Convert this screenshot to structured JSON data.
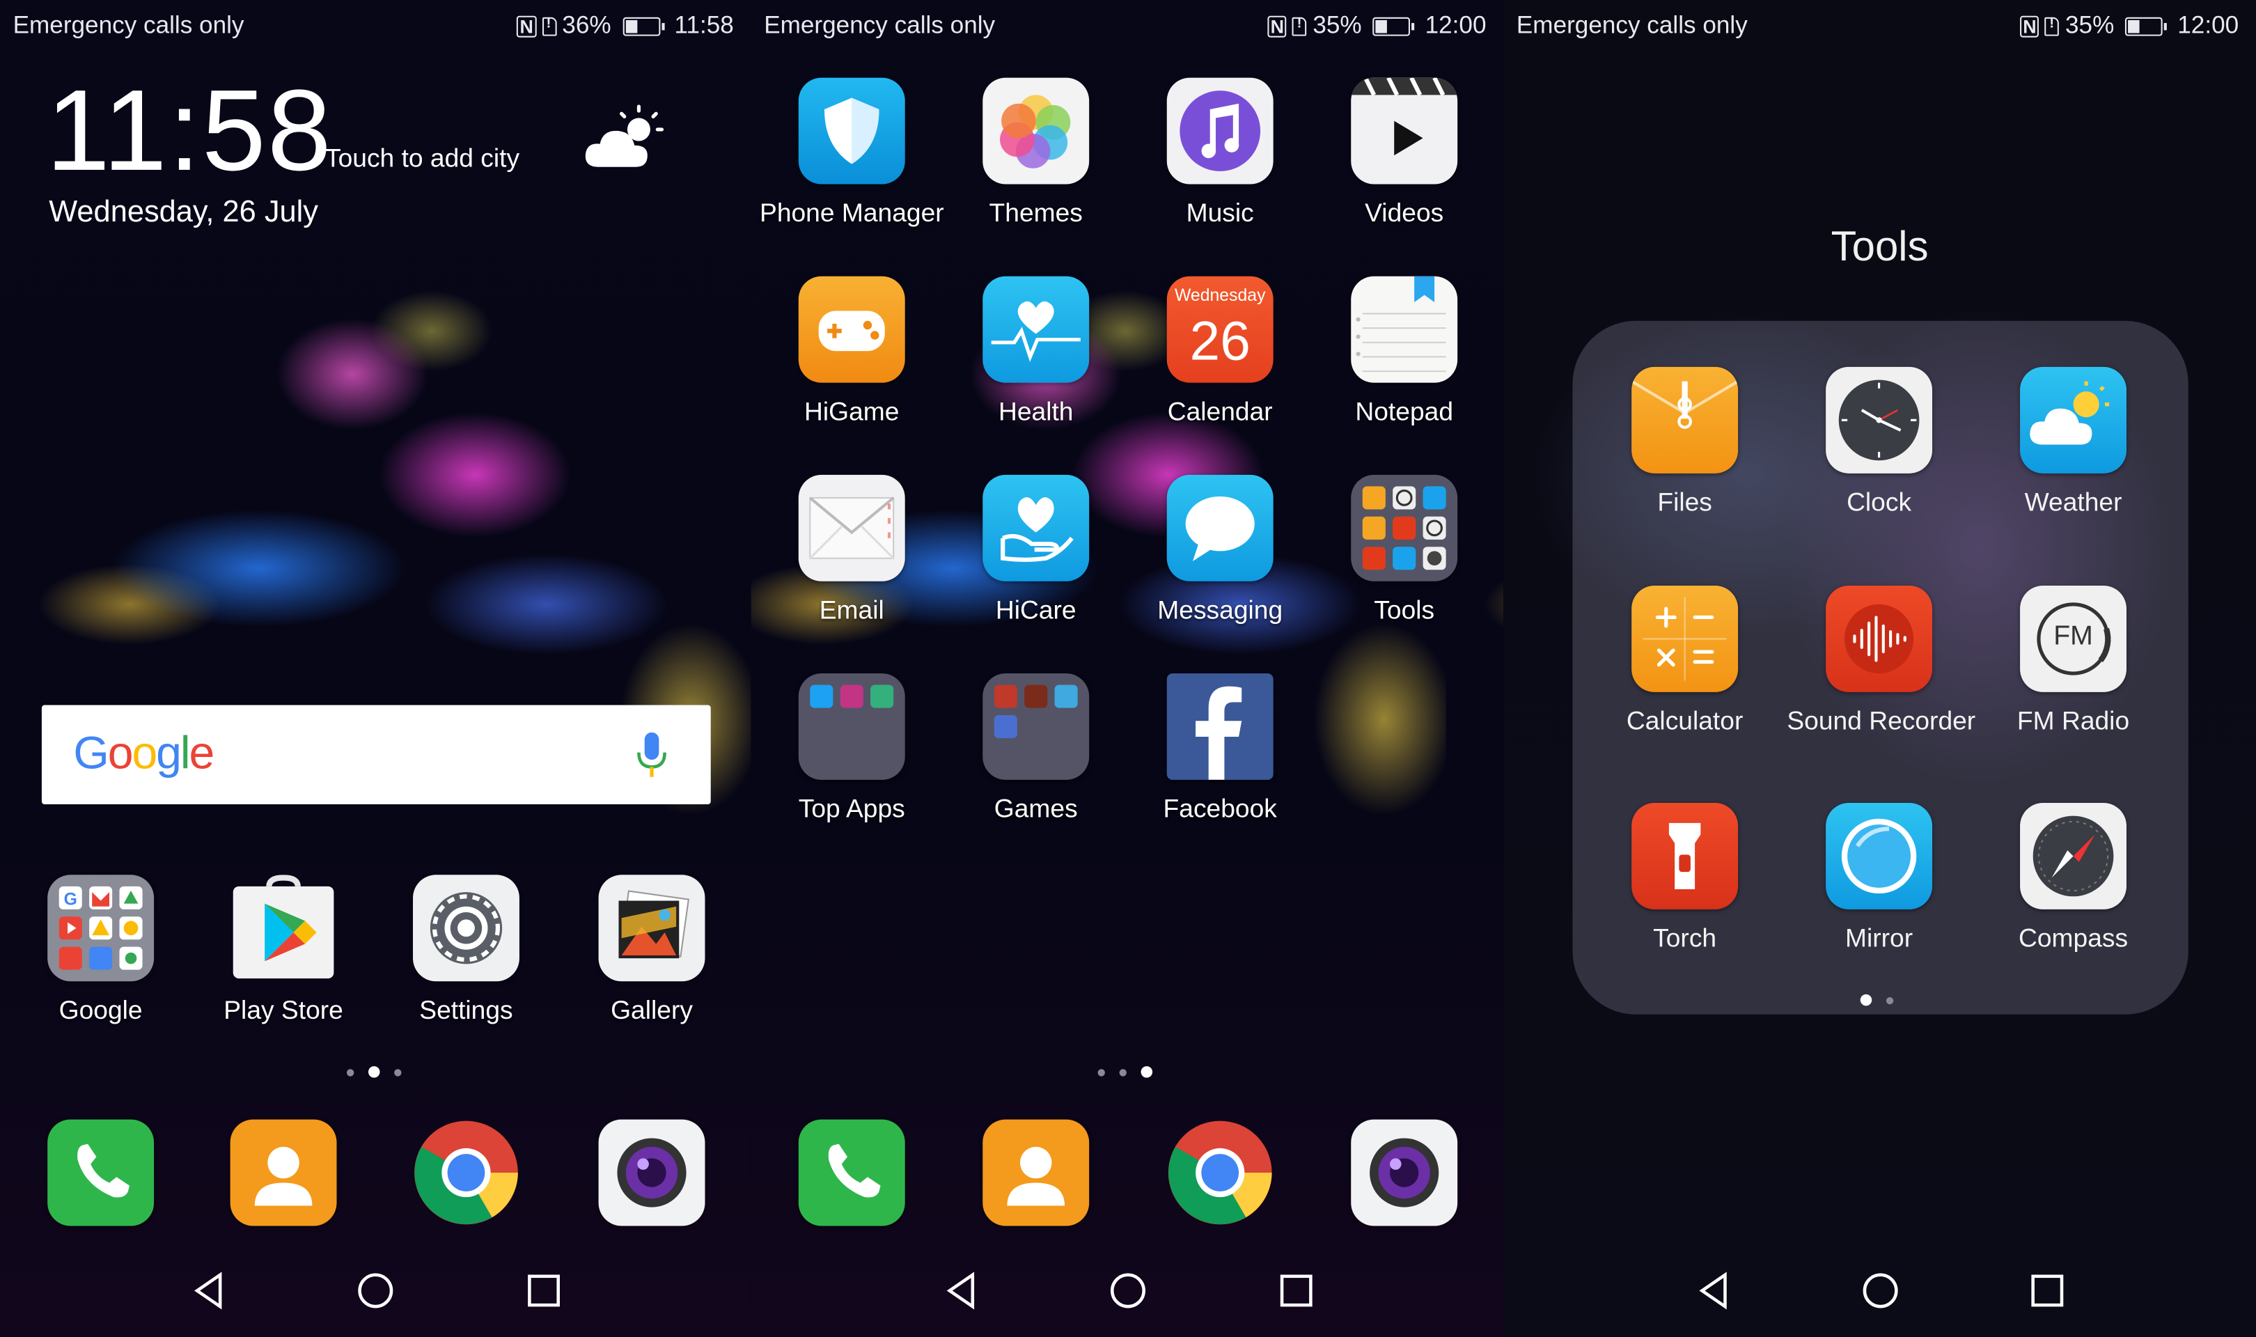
{
  "status_bars": [
    {
      "carrier": "Emergency calls only",
      "battery": "36%",
      "battery_level": 0.36,
      "time": "11:58",
      "nfc": "N"
    },
    {
      "carrier": "Emergency calls only",
      "battery": "35%",
      "battery_level": 0.35,
      "time": "12:00",
      "nfc": "N"
    },
    {
      "carrier": "Emergency calls only",
      "battery": "35%",
      "battery_level": 0.35,
      "time": "12:00",
      "nfc": "N"
    }
  ],
  "clock_widget": {
    "time": "11:58",
    "city_prompt": "Touch to add city",
    "date": "Wednesday, 26 July",
    "weather_icon": "partly-cloudy-day-icon"
  },
  "search": {
    "logo": [
      "G",
      "o",
      "o",
      "g",
      "l",
      "e"
    ],
    "logo_colors": [
      "#4285F4",
      "#EA4335",
      "#FBBC05",
      "#4285F4",
      "#34A853",
      "#EA4335"
    ],
    "mic_icon": "mic-icon"
  },
  "home1": {
    "apps": [
      {
        "label": "Google",
        "icon": "google-folder-icon"
      },
      {
        "label": "Play Store",
        "icon": "play-store-icon"
      },
      {
        "label": "Settings",
        "icon": "settings-gear-icon"
      },
      {
        "label": "Gallery",
        "icon": "gallery-icon"
      }
    ],
    "page_indicator": {
      "pages": 3,
      "current": 2
    }
  },
  "home2": {
    "apps": [
      {
        "label": "Phone Manager",
        "icon": "phone-manager-shield-icon"
      },
      {
        "label": "Themes",
        "icon": "themes-icon"
      },
      {
        "label": "Music",
        "icon": "music-note-icon"
      },
      {
        "label": "Videos",
        "icon": "videos-play-icon"
      },
      {
        "label": "HiGame",
        "icon": "gamepad-icon"
      },
      {
        "label": "Health",
        "icon": "health-heart-icon"
      },
      {
        "label": "Calendar",
        "icon": "calendar-icon",
        "day_name": "Wednesday",
        "day_number": "26"
      },
      {
        "label": "Notepad",
        "icon": "notepad-icon"
      },
      {
        "label": "Email",
        "icon": "email-envelope-icon"
      },
      {
        "label": "HiCare",
        "icon": "hicare-hand-heart-icon"
      },
      {
        "label": "Messaging",
        "icon": "messaging-bubble-icon"
      },
      {
        "label": "Tools",
        "icon": "tools-folder-icon"
      },
      {
        "label": "Top Apps",
        "icon": "top-apps-folder-icon"
      },
      {
        "label": "Games",
        "icon": "games-folder-icon"
      },
      {
        "label": "Facebook",
        "icon": "facebook-icon"
      }
    ],
    "page_indicator": {
      "pages": 3,
      "current": 3
    }
  },
  "dock": [
    {
      "name": "phone",
      "icon": "phone-handset-icon"
    },
    {
      "name": "contacts",
      "icon": "contacts-person-icon"
    },
    {
      "name": "chrome",
      "icon": "chrome-icon"
    },
    {
      "name": "camera",
      "icon": "camera-lens-icon"
    }
  ],
  "folder": {
    "title": "Tools",
    "apps": [
      {
        "label": "Files",
        "icon": "files-folder-icon"
      },
      {
        "label": "Clock",
        "icon": "clock-icon"
      },
      {
        "label": "Weather",
        "icon": "weather-cloud-sun-icon"
      },
      {
        "label": "Calculator",
        "icon": "calculator-icon"
      },
      {
        "label": "Sound Recorder",
        "icon": "sound-recorder-waveform-icon"
      },
      {
        "label": "FM Radio",
        "icon": "fm-radio-icon",
        "glyph": "FM"
      },
      {
        "label": "Torch",
        "icon": "torch-flashlight-icon"
      },
      {
        "label": "Mirror",
        "icon": "mirror-circle-icon"
      },
      {
        "label": "Compass",
        "icon": "compass-icon"
      }
    ],
    "page_indicator": {
      "pages": 2,
      "current": 1
    }
  },
  "navbar": {
    "back": "back-triangle-icon",
    "home": "home-circle-icon",
    "recent": "recent-square-icon"
  }
}
